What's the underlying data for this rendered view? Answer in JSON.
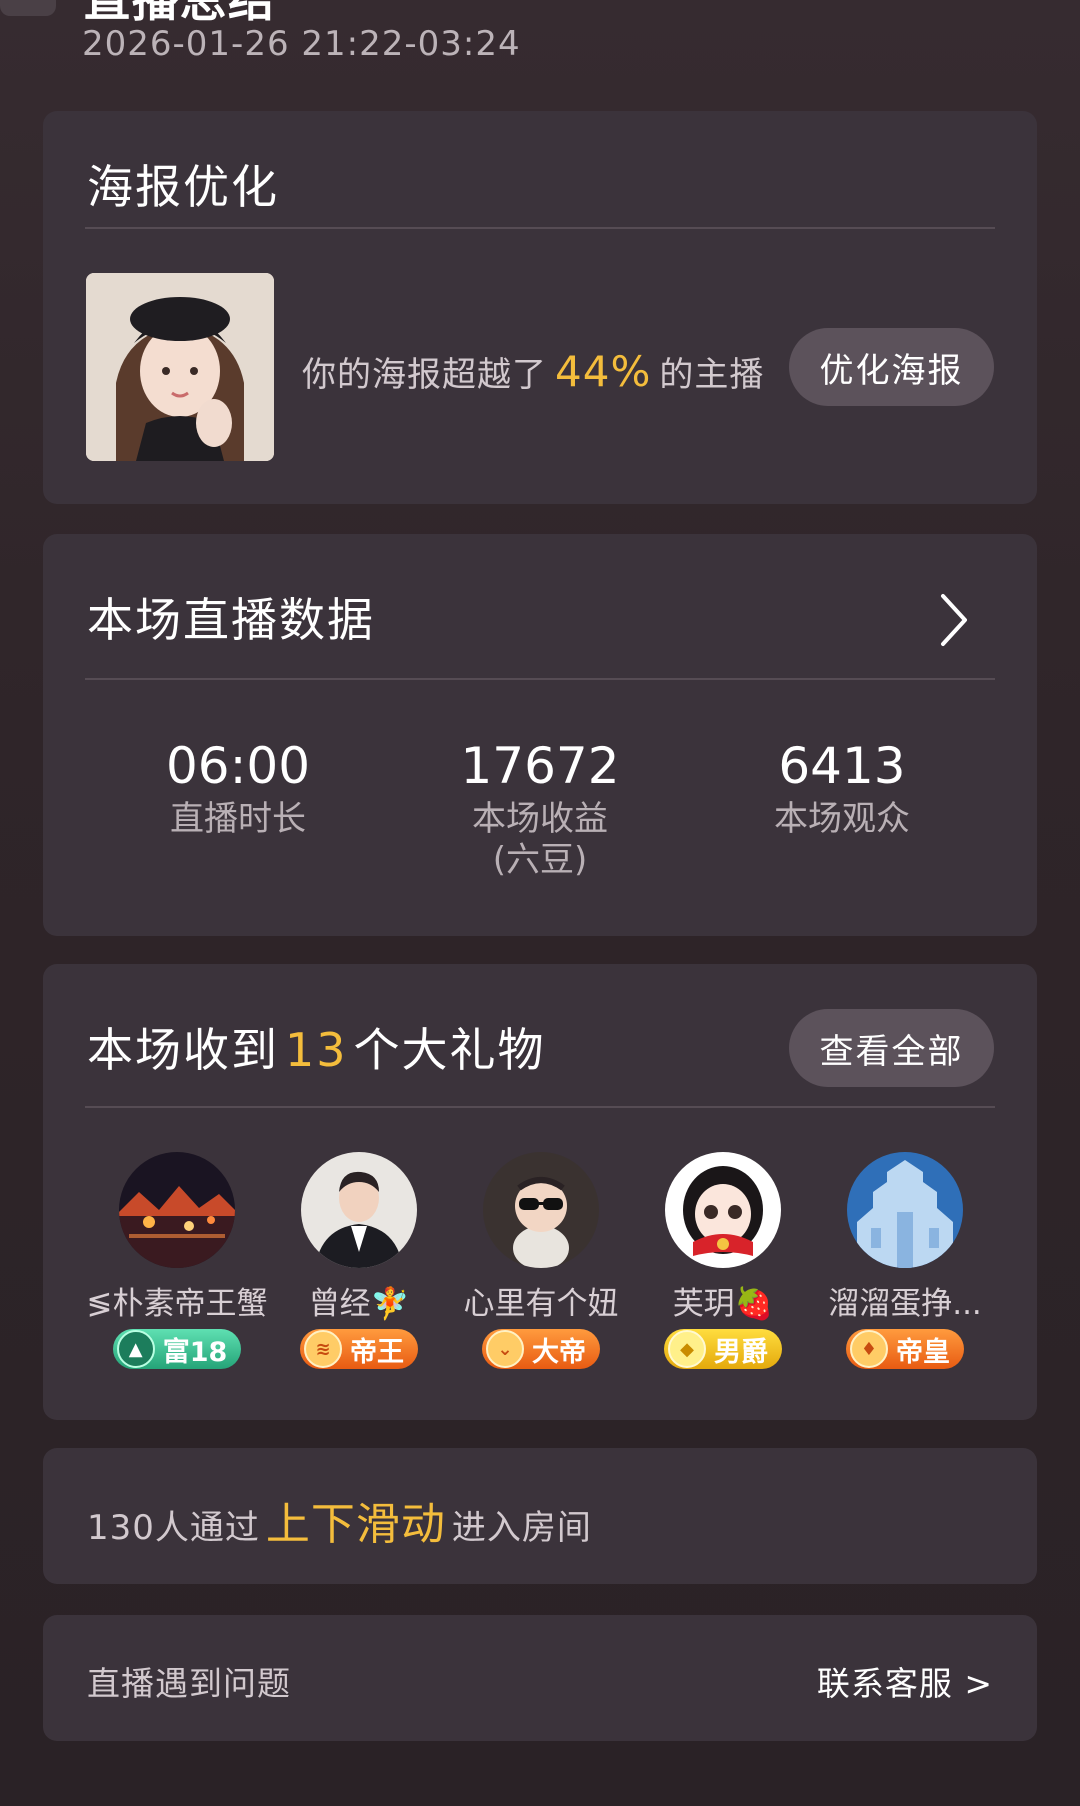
{
  "header": {
    "title": "直播总结",
    "time_range": "2026-01-26 21:22-03:24"
  },
  "poster": {
    "title": "海报优化",
    "text_before": "你的海报超越了",
    "percent": "44%",
    "text_after": "的主播",
    "button": "优化海报"
  },
  "stats": {
    "title": "本场直播数据",
    "items": [
      {
        "value": "06:00",
        "label": "直播时长",
        "sub": ""
      },
      {
        "value": "17672",
        "label": "本场收益",
        "sub": "(六豆)"
      },
      {
        "value": "6413",
        "label": "本场观众",
        "sub": ""
      }
    ]
  },
  "gifts": {
    "title_before": "本场收到",
    "count": "13",
    "title_after": "个大礼物",
    "button": "查看全部",
    "givers": [
      {
        "name": "≶朴素帝王蟹",
        "badge": "富18",
        "badge_color": "#2fb886",
        "badge_icon": "triangle-icon"
      },
      {
        "name": "曾经🧚",
        "badge": "帝王",
        "badge_color": "#f07420",
        "badge_icon": "shield-icon"
      },
      {
        "name": "心里有个妞",
        "badge": "大帝",
        "badge_color": "#f07420",
        "badge_icon": "chevron-icon"
      },
      {
        "name": "芙玥🍓",
        "badge": "男爵",
        "badge_color": "#efbd1d",
        "badge_icon": "diamond-icon"
      },
      {
        "name": "溜溜蛋挣...",
        "badge": "帝皇",
        "badge_color": "#f07420",
        "badge_icon": "gem-icon"
      }
    ]
  },
  "swipe": {
    "count_text": "130人通过",
    "highlight": "上下滑动",
    "text_after": "进入房间"
  },
  "help": {
    "text": "直播遇到问题",
    "link": "联系客服 >"
  },
  "colors": {
    "accent": "#f4bd3c",
    "card_bg": "#3b333b",
    "page_bg": "#2f2529"
  }
}
